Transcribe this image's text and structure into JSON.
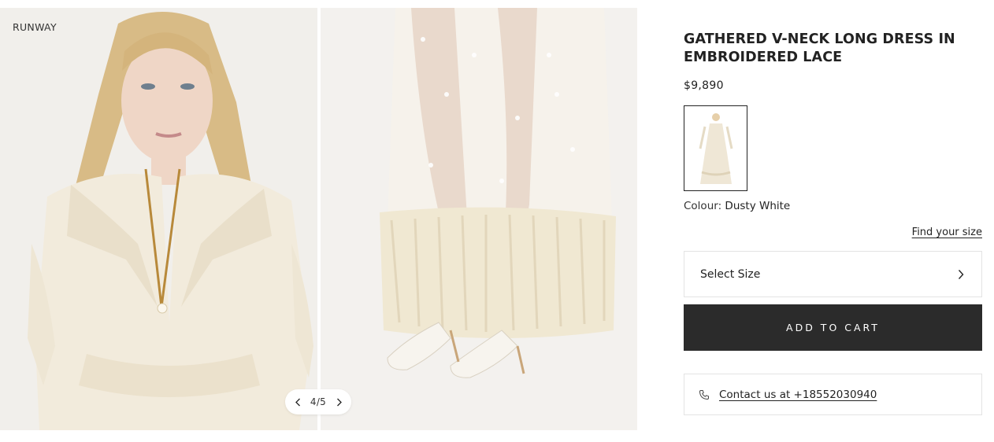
{
  "gallery": {
    "runway_label": "RUNWAY",
    "pager": {
      "count": "4/5",
      "prev_icon": "chevron-left-icon",
      "next_icon": "chevron-right-icon"
    },
    "images": [
      {
        "name": "model-upper-body-photo"
      },
      {
        "name": "dress-hem-shoes-photo"
      }
    ]
  },
  "product": {
    "title_line1": "GATHERED V-NECK LONG DRESS IN",
    "title_line2": "EMBROIDERED LACE",
    "price": "$9,890",
    "colour_label": "Colour:",
    "colour_value": "Dusty White",
    "find_size": "Find your size",
    "size_select": "Select Size",
    "add_to_cart": "ADD TO CART",
    "contact": "Contact us at +18552030940"
  },
  "colors": {
    "button_bg": "#2b2b2b",
    "border": "#e3e3e3",
    "dress": "#f2ebdc",
    "photo_bg": "#f1efeb"
  }
}
